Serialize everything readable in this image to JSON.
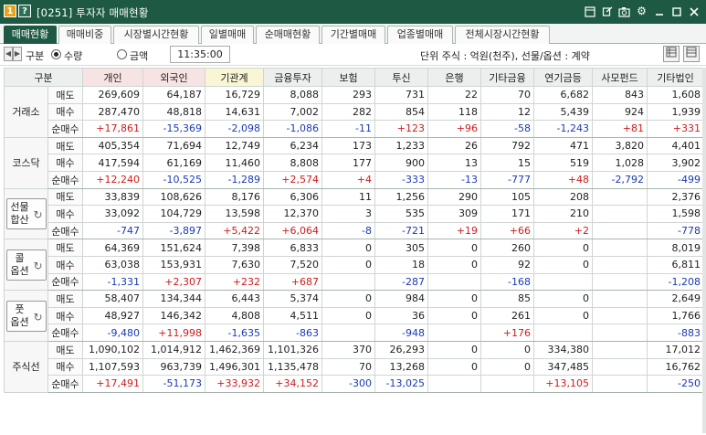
{
  "title_bar": {
    "badge1": "1",
    "badge2": "?",
    "title": "[0251] 투자자 매매현황"
  },
  "tabs": [
    "매매현황",
    "매매비중",
    "시장별시간현황",
    "일별매매",
    "순매매현황",
    "기간별매매",
    "업종별매매",
    "전체시장시간현황"
  ],
  "toolbar": {
    "section_label": "구분",
    "radio_qty": "수량",
    "radio_amt": "금액",
    "time": "11:35:00",
    "unit_text": "단위 주식 : 억원(천주), 선물/옵션 : 계약"
  },
  "table": {
    "headers": [
      "구분",
      "",
      "개인",
      "외국인",
      "기관계",
      "금융투자",
      "보험",
      "투신",
      "은행",
      "기타금융",
      "연기금등",
      "사모펀드",
      "기타법인"
    ],
    "row_labels": [
      "매도",
      "매수",
      "순매수"
    ],
    "groups": [
      {
        "name": "거래소",
        "rows": [
          [
            "269,609",
            "64,187",
            "16,729",
            "8,088",
            "293",
            "731",
            "22",
            "70",
            "6,682",
            "843",
            "1,608"
          ],
          [
            "287,470",
            "48,818",
            "14,631",
            "7,002",
            "282",
            "854",
            "118",
            "12",
            "5,439",
            "924",
            "1,939"
          ],
          [
            "+17,861",
            "-15,369",
            "-2,098",
            "-1,086",
            "-11",
            "+123",
            "+96",
            "-58",
            "-1,243",
            "+81",
            "+331"
          ]
        ]
      },
      {
        "name": "코스닥",
        "rows": [
          [
            "405,354",
            "71,694",
            "12,749",
            "6,234",
            "173",
            "1,233",
            "26",
            "792",
            "471",
            "3,820",
            "4,401"
          ],
          [
            "417,594",
            "61,169",
            "11,460",
            "8,808",
            "177",
            "900",
            "13",
            "15",
            "519",
            "1,028",
            "3,902"
          ],
          [
            "+12,240",
            "-10,525",
            "-1,289",
            "+2,574",
            "+4",
            "-333",
            "-13",
            "-777",
            "+48",
            "-2,792",
            "-499"
          ]
        ]
      },
      {
        "name": "선물\n합산",
        "button": true,
        "rows": [
          [
            "33,839",
            "108,626",
            "8,176",
            "6,306",
            "11",
            "1,256",
            "290",
            "105",
            "208",
            "",
            "2,376"
          ],
          [
            "33,092",
            "104,729",
            "13,598",
            "12,370",
            "3",
            "535",
            "309",
            "171",
            "210",
            "",
            "1,598"
          ],
          [
            "-747",
            "-3,897",
            "+5,422",
            "+6,064",
            "-8",
            "-721",
            "+19",
            "+66",
            "+2",
            "",
            "-778"
          ]
        ]
      },
      {
        "name": "콜\n옵션",
        "button": true,
        "rows": [
          [
            "64,369",
            "151,624",
            "7,398",
            "6,833",
            "0",
            "305",
            "0",
            "260",
            "0",
            "",
            "8,019"
          ],
          [
            "63,038",
            "153,931",
            "7,630",
            "7,520",
            "0",
            "18",
            "0",
            "92",
            "0",
            "",
            "6,811"
          ],
          [
            "-1,331",
            "+2,307",
            "+232",
            "+687",
            "",
            "-287",
            "",
            "-168",
            "",
            "",
            "-1,208"
          ]
        ]
      },
      {
        "name": "풋\n옵션",
        "button": true,
        "rows": [
          [
            "58,407",
            "134,344",
            "6,443",
            "5,374",
            "0",
            "984",
            "0",
            "85",
            "0",
            "",
            "2,649"
          ],
          [
            "48,927",
            "146,342",
            "4,808",
            "4,511",
            "0",
            "36",
            "0",
            "261",
            "0",
            "",
            "1,766"
          ],
          [
            "-9,480",
            "+11,998",
            "-1,635",
            "-863",
            "",
            "-948",
            "",
            "+176",
            "",
            "",
            "-883"
          ]
        ]
      },
      {
        "name": "주식선",
        "rows": [
          [
            "1,090,102",
            "1,014,912",
            "1,462,369",
            "1,101,326",
            "370",
            "26,293",
            "0",
            "0",
            "334,380",
            "",
            "17,012"
          ],
          [
            "1,107,593",
            "963,739",
            "1,496,301",
            "1,135,478",
            "70",
            "13,268",
            "0",
            "0",
            "347,485",
            "",
            "16,762"
          ],
          [
            "+17,491",
            "-51,173",
            "+33,932",
            "+34,152",
            "-300",
            "-13,025",
            "",
            "",
            "+13,105",
            "",
            "-250"
          ]
        ]
      }
    ]
  },
  "colors": {
    "title_bg": "#1e5a43",
    "positive": "#d11b1b",
    "negative": "#1a3ab8",
    "accent_badge": "#e8a21a"
  },
  "icons": {
    "title_bar": [
      "pin-icon",
      "link-icon",
      "camera-icon",
      "gear-icon",
      "minimize-icon",
      "maximize-icon",
      "close-icon"
    ],
    "toolbar": [
      "prev-arrow-icon",
      "next-arrow-icon",
      "list-icon",
      "grid-icon"
    ]
  }
}
